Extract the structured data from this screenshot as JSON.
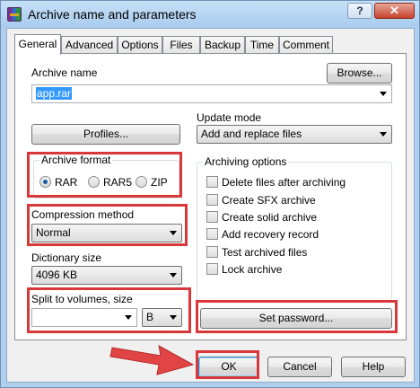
{
  "window": {
    "title": "Archive name and parameters",
    "help_glyph": "?",
    "close_glyph": "✕"
  },
  "tabs": [
    {
      "label": "General",
      "active": true
    },
    {
      "label": "Advanced"
    },
    {
      "label": "Options"
    },
    {
      "label": "Files"
    },
    {
      "label": "Backup"
    },
    {
      "label": "Time"
    },
    {
      "label": "Comment"
    }
  ],
  "general": {
    "archive_name_label": "Archive name",
    "archive_name_value": "app.rar",
    "browse_label": "Browse...",
    "profiles_label": "Profiles...",
    "update_mode_label": "Update mode",
    "update_mode_value": "Add and replace files",
    "archive_format": {
      "label": "Archive format",
      "options": [
        "RAR",
        "RAR5",
        "ZIP"
      ],
      "selected": "RAR"
    },
    "compression_method": {
      "label": "Compression method",
      "value": "Normal"
    },
    "dictionary_size": {
      "label": "Dictionary size",
      "value": "4096 KB"
    },
    "split_volumes": {
      "label": "Split to volumes, size",
      "size_value": "",
      "unit_value": "B"
    },
    "archiving_options": {
      "label": "Archiving options",
      "items": [
        {
          "label": "Delete files after archiving",
          "checked": false
        },
        {
          "label": "Create SFX archive",
          "checked": false
        },
        {
          "label": "Create solid archive",
          "checked": false
        },
        {
          "label": "Add recovery record",
          "checked": false
        },
        {
          "label": "Test archived files",
          "checked": false
        },
        {
          "label": "Lock archive",
          "checked": false
        }
      ]
    },
    "set_password_label": "Set password..."
  },
  "footer": {
    "ok_label": "OK",
    "cancel_label": "Cancel",
    "help_label": "Help"
  },
  "colors": {
    "highlight": "#d9383a",
    "selection": "#3399ff"
  },
  "icons": {
    "app": "winrar-icon",
    "arrow": "red-arrow-annotation"
  }
}
